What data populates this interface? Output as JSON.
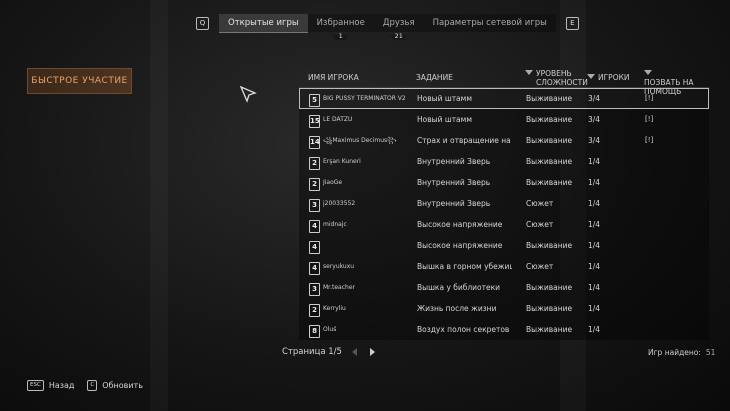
{
  "top_nav": {
    "left_key": "Q",
    "right_key": "E",
    "tabs": [
      {
        "label": "Открытые игры",
        "active": true,
        "count": ""
      },
      {
        "label": "Избранное",
        "active": false,
        "count": "1"
      },
      {
        "label": "Друзья",
        "active": false,
        "count": "21"
      },
      {
        "label": "Параметры сетевой игры",
        "active": false,
        "count": ""
      }
    ]
  },
  "quick_join_label": "БЫСТРОЕ УЧАСТИЕ",
  "table": {
    "headers": {
      "player_name": "ИМЯ ИГРОКА",
      "task": "ЗАДАНИЕ",
      "difficulty": "УРОВЕНЬ СЛОЖНОСТИ",
      "players": "ИГРОКИ",
      "call_for_help": "ПОЗВАТЬ НА ПОМОЩЬ"
    },
    "rows": [
      {
        "level": "5",
        "name": "BIG PUSSY TERMINATOR V2",
        "task": "Новый штамм",
        "difficulty": "Выживание",
        "players": "3/4",
        "help": "[!]"
      },
      {
        "level": "15",
        "name": "LE DATZU",
        "task": "Новый штамм",
        "difficulty": "Выживание",
        "players": "3/4",
        "help": "[!]"
      },
      {
        "level": "14",
        "name": "꧁Maximus Decimus꧂",
        "task": "Страх и отвращение на ц",
        "difficulty": "Выживание",
        "players": "3/4",
        "help": "[!]"
      },
      {
        "level": "2",
        "name": "Erşan Kuneri",
        "task": "Внутренний Зверь",
        "difficulty": "Выживание",
        "players": "1/4",
        "help": ""
      },
      {
        "level": "2",
        "name": "JiaoGe",
        "task": "Внутренний Зверь",
        "difficulty": "Выживание",
        "players": "1/4",
        "help": ""
      },
      {
        "level": "3",
        "name": "j20033552",
        "task": "Внутренний Зверь",
        "difficulty": "Сюжет",
        "players": "1/4",
        "help": ""
      },
      {
        "level": "4",
        "name": "midnajc",
        "task": "Высокое напряжение",
        "difficulty": "Сюжет",
        "players": "1/4",
        "help": ""
      },
      {
        "level": "4",
        "name": "ᅟᅟᅟᅟ",
        "task": "Высокое напряжение",
        "difficulty": "Выживание",
        "players": "1/4",
        "help": ""
      },
      {
        "level": "4",
        "name": "seryukuxu",
        "task": "Вышка в горном убежищ",
        "difficulty": "Сюжет",
        "players": "1/4",
        "help": ""
      },
      {
        "level": "3",
        "name": "Mr.teacher",
        "task": "Вышка у библиотеки",
        "difficulty": "Выживание",
        "players": "1/4",
        "help": ""
      },
      {
        "level": "2",
        "name": "Kerryliu",
        "task": "Жизнь после жизни",
        "difficulty": "Выживание",
        "players": "1/4",
        "help": ""
      },
      {
        "level": "8",
        "name": "Oluś",
        "task": "Воздух полон секретов",
        "difficulty": "Выживание",
        "players": "1/4",
        "help": ""
      }
    ]
  },
  "pager": {
    "label": "Страница 1/5"
  },
  "games_found": {
    "label": "Игр найдено:",
    "value": "51"
  },
  "bottom_actions": [
    {
      "key": "ESC",
      "label": "Назад"
    },
    {
      "key": "C",
      "label": "Обновить"
    }
  ],
  "colors": {
    "accent": "#e9a26a",
    "quick_join_bg": "#4d3422"
  }
}
